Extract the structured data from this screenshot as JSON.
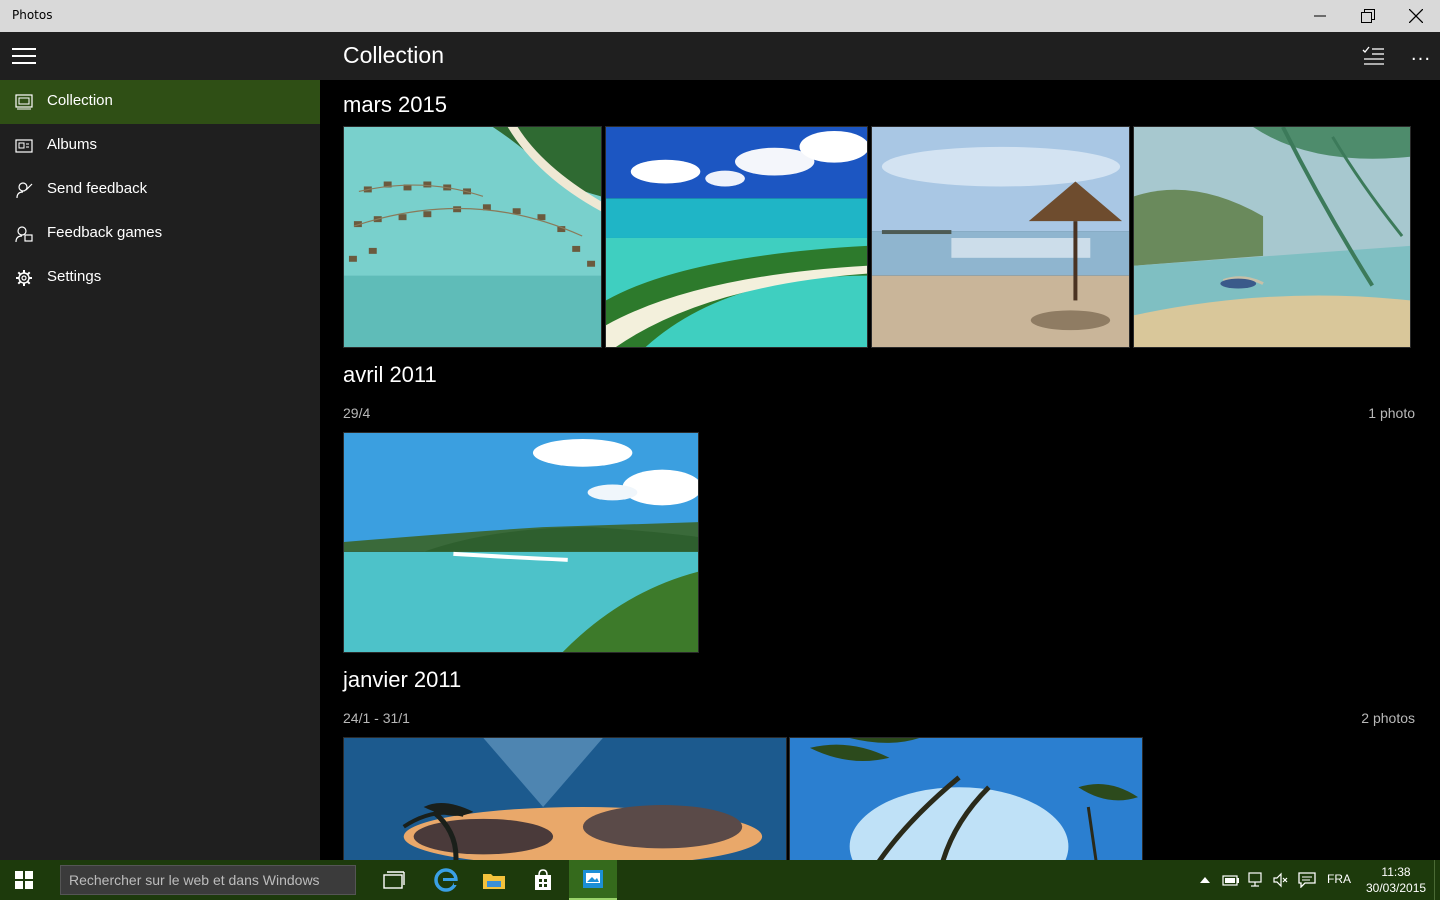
{
  "window": {
    "title": "Photos"
  },
  "sidebar": {
    "items": [
      {
        "label": "Collection",
        "icon": "collection-icon",
        "active": true
      },
      {
        "label": "Albums",
        "icon": "album-icon",
        "active": false
      },
      {
        "label": "Send feedback",
        "icon": "feedback-icon",
        "active": false
      },
      {
        "label": "Feedback games",
        "icon": "feedback-games-icon",
        "active": false
      },
      {
        "label": "Settings",
        "icon": "gear-icon",
        "active": false
      }
    ]
  },
  "header": {
    "title": "Collection",
    "more_label": "..."
  },
  "groups": [
    {
      "title": "mars 2015",
      "subtitle": "",
      "count": "",
      "photos": [
        "overwater-bungalows",
        "aerial-beach-island",
        "beach-parasol",
        "painted-seascape"
      ]
    },
    {
      "title": "avril 2011",
      "subtitle": "29/4",
      "count": "1 photo",
      "photos": [
        "whitehaven-beach"
      ]
    },
    {
      "title": "janvier 2011",
      "subtitle": "24/1 - 31/1",
      "count": "2 photos",
      "photos": [
        "sunset-palm",
        "palm-trees-sky"
      ]
    }
  ],
  "taskbar": {
    "search_placeholder": "Rechercher sur le web et dans Windows",
    "apps": [
      "task-view-icon",
      "edge-browser-icon",
      "file-explorer-icon",
      "store-icon",
      "photos-app-icon"
    ],
    "active_app": "photos-app-icon",
    "language": "FRA",
    "time": "11:38",
    "date": "30/03/2015"
  },
  "colors": {
    "accent": "#2f4f15",
    "taskbar": "#1d3a0c",
    "sidebar": "#1f1f1f",
    "content": "#000000"
  }
}
